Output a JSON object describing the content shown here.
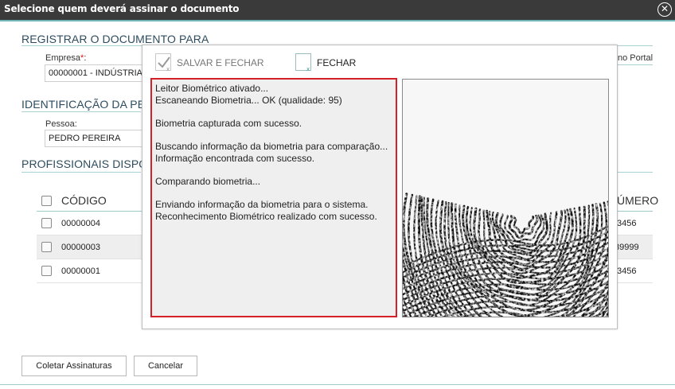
{
  "window": {
    "title": "Selecione quem deverá assinar o documento",
    "close_glyph": "✕"
  },
  "register_section": {
    "heading": "REGISTRAR O DOCUMENTO PARA",
    "company_label": "Empresa",
    "required_mark": "*",
    "label_suffix": ":",
    "company_value": "00000001 - INDÚSTRIA",
    "right_fragment": "no Portal"
  },
  "identification_section": {
    "heading": "IDENTIFICAÇÃO DA PES",
    "person_label": "Pessoa:",
    "person_value": "PEDRO PEREIRA"
  },
  "professionals_section": {
    "heading": "PROFISSIONAIS DISPON",
    "columns": {
      "code": "CÓDIGO",
      "number": "ÚMERO"
    },
    "rows": [
      {
        "code": "00000004",
        "number": "3456"
      },
      {
        "code": "00000003",
        "number": "39999"
      },
      {
        "code": "00000001",
        "number": "3456"
      }
    ]
  },
  "footer": {
    "collect_label": "Coletar Assinaturas",
    "cancel_label": "Cancelar"
  },
  "modal": {
    "save_close_label": "SALVAR E FECHAR",
    "close_label": "FECHAR",
    "log_lines": [
      "Leitor Biométrico ativado...",
      "Escaneando Biometria... OK (qualidade: 95)",
      "",
      "Biometria capturada com sucesso.",
      "",
      "Buscando informação da biometria para comparação...",
      "Informação encontrada com sucesso.",
      "",
      "Comparando biometria...",
      "",
      "Enviando informação da biometria para o sistema.",
      "Reconhecimento Biométrico realizado com sucesso."
    ],
    "icons": {
      "save": "save-close-icon",
      "close": "close-icon",
      "fingerprint": "fingerprint-image"
    }
  },
  "colors": {
    "titlebar": "#3a3a3a",
    "accent_line": "#6fb7b7",
    "heading_text": "#2d4c5f",
    "alert_border": "#d62027",
    "row_alt": "#eeeeee"
  }
}
